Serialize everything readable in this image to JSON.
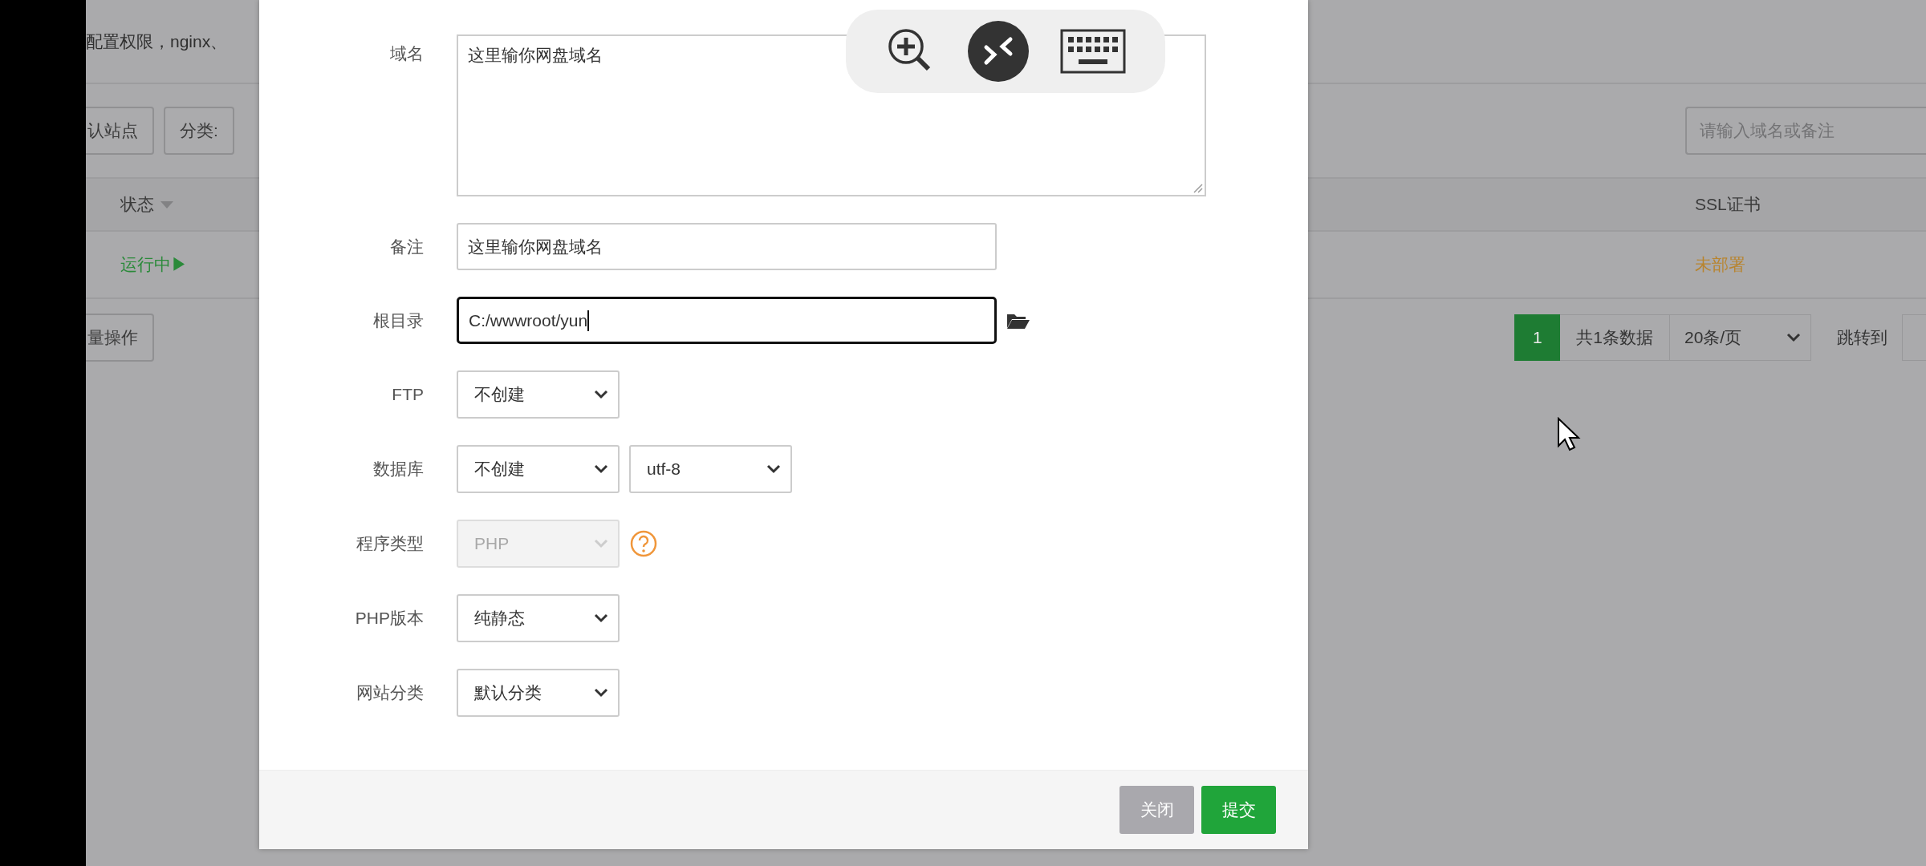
{
  "background_page": {
    "notice": "配置权限，nginx、",
    "toolbar": {
      "buttons": [
        "认站点",
        "分类:"
      ],
      "search": {
        "placeholder": "请输入域名或备注"
      }
    },
    "table": {
      "columns": [
        {
          "label": "状态",
          "sortable": true
        },
        {
          "label": "SSL证书",
          "sortable": false
        }
      ],
      "rows": [
        {
          "status": "运行中▶",
          "ssl": "未部署"
        }
      ]
    },
    "batch_button": "量操作",
    "pagination": {
      "pages": [
        {
          "label": "1",
          "selected": true
        }
      ],
      "total": "共1条数据",
      "page_size": "20条/页",
      "jump_label": "跳转到"
    }
  },
  "dialog": {
    "fields": [
      {
        "label": "域名",
        "kind": "textarea",
        "value": "这里输你网盘域名",
        "browse_button": false,
        "help_icon": false
      },
      {
        "label": "备注",
        "kind": "text",
        "value": "这里输你网盘域名",
        "focused": false,
        "browse_button": false,
        "help_icon": false
      },
      {
        "label": "根目录",
        "kind": "text",
        "value": "C:/wwwroot/yun",
        "focused": true,
        "browse_button": true,
        "help_icon": false
      },
      {
        "label": "FTP",
        "kind": "select",
        "selects": [
          {
            "value": "不创建",
            "disabled": false
          }
        ],
        "browse_button": false,
        "help_icon": false
      },
      {
        "label": "数据库",
        "kind": "select",
        "selects": [
          {
            "value": "不创建",
            "disabled": false
          },
          {
            "value": "utf-8",
            "disabled": false
          }
        ],
        "browse_button": false,
        "help_icon": false
      },
      {
        "label": "程序类型",
        "kind": "select",
        "selects": [
          {
            "value": "PHP",
            "disabled": true
          }
        ],
        "browse_button": false,
        "help_icon": true
      },
      {
        "label": "PHP版本",
        "kind": "select",
        "selects": [
          {
            "value": "纯静态",
            "disabled": false
          }
        ],
        "browse_button": false,
        "help_icon": false
      },
      {
        "label": "网站分类",
        "kind": "select",
        "selects": [
          {
            "value": "默认分类",
            "disabled": false
          }
        ],
        "browse_button": false,
        "help_icon": false
      }
    ],
    "buttons": [
      {
        "label": "关闭",
        "kind": "secondary"
      },
      {
        "label": "提交",
        "kind": "primary"
      }
    ]
  },
  "remote_toolbar": {
    "buttons": [
      {
        "kind": "zoom"
      },
      {
        "kind": "connection"
      },
      {
        "kind": "keyboard"
      }
    ]
  }
}
